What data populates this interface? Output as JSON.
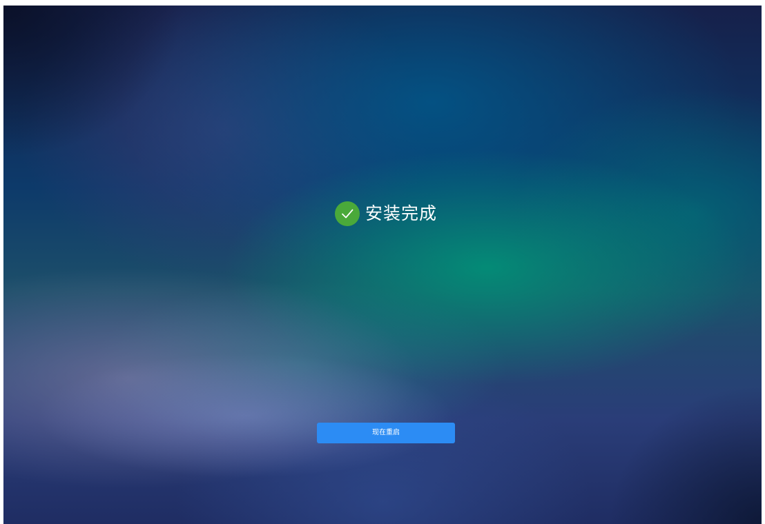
{
  "status": {
    "icon": "check-circle-icon",
    "title": "安装完成"
  },
  "actions": {
    "reboot_label": "现在重启"
  },
  "colors": {
    "success": "#4aa93a",
    "button": "#2c8cf4",
    "text": "#ffffff"
  }
}
